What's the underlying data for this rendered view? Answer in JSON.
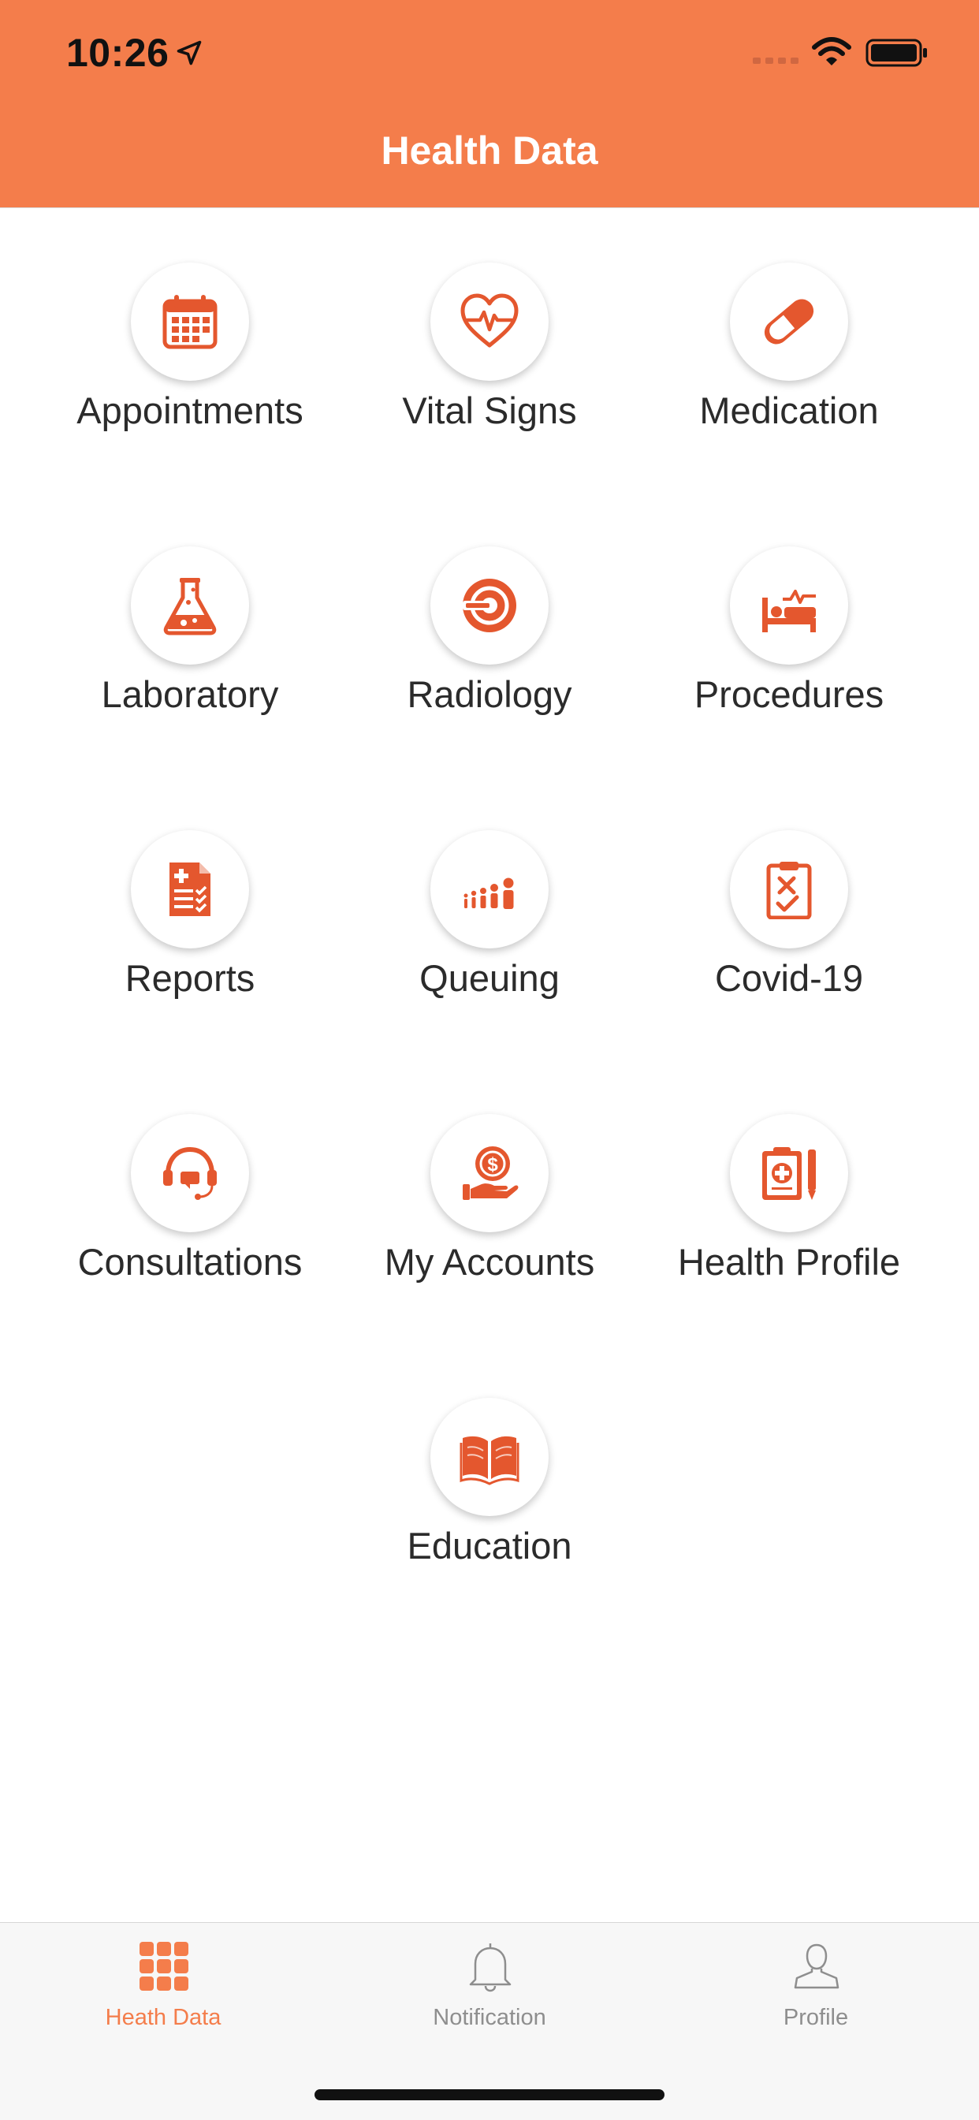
{
  "status_bar": {
    "time": "10:26"
  },
  "header": {
    "title": "Health Data"
  },
  "colors": {
    "accent": "#F47D4B",
    "icon": "#E4572E",
    "tab_inactive": "#8e8e8e"
  },
  "menu": [
    {
      "label": "Appointments",
      "icon": "calendar-icon"
    },
    {
      "label": "Vital Signs",
      "icon": "heartbeat-icon"
    },
    {
      "label": "Medication",
      "icon": "pill-icon"
    },
    {
      "label": "Laboratory",
      "icon": "flask-icon"
    },
    {
      "label": "Radiology",
      "icon": "mri-scanner-icon"
    },
    {
      "label": "Procedures",
      "icon": "hospital-bed-icon"
    },
    {
      "label": "Reports",
      "icon": "medical-report-icon"
    },
    {
      "label": "Queuing",
      "icon": "queue-people-icon"
    },
    {
      "label": "Covid-19",
      "icon": "clipboard-check-icon"
    },
    {
      "label": "Consultations",
      "icon": "headset-icon"
    },
    {
      "label": "My Accounts",
      "icon": "dollar-hand-icon"
    },
    {
      "label": "Health Profile",
      "icon": "health-record-icon"
    },
    {
      "label": "Education",
      "icon": "open-book-icon"
    }
  ],
  "tabbar": {
    "tabs": [
      {
        "label": "Heath Data",
        "icon": "grid-icon",
        "active": true
      },
      {
        "label": "Notification",
        "icon": "bell-icon",
        "active": false
      },
      {
        "label": "Profile",
        "icon": "user-icon",
        "active": false
      }
    ]
  }
}
